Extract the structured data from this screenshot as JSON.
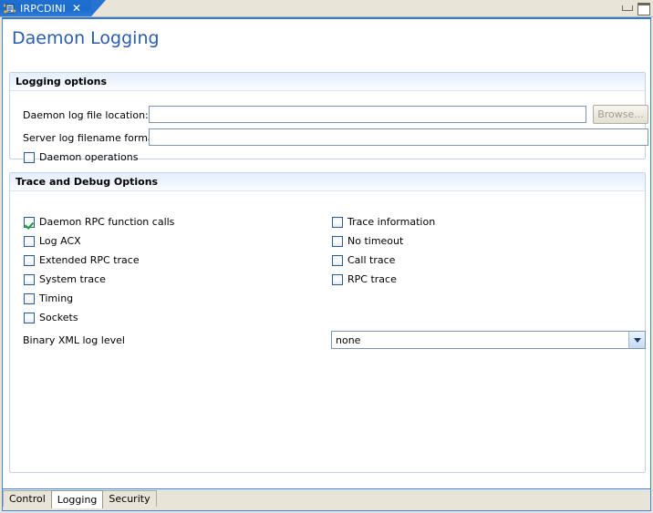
{
  "window": {
    "minimize_icon": "minimize-icon",
    "maximize_icon": "maximize-icon"
  },
  "editor_tab": {
    "label": "IRPCDINI",
    "close_label": "✕",
    "icon": "config-file-icon"
  },
  "page": {
    "title": "Daemon Logging"
  },
  "logging_options": {
    "header": "Logging options",
    "log_file_location_label": "Daemon log file location:",
    "log_file_location_value": "",
    "log_file_location_placeholder": "",
    "browse_label": "Browse...",
    "server_log_format_label": "Server log filename format:",
    "server_log_format_value": "",
    "server_log_format_placeholder": "",
    "daemon_operations_label": "Daemon operations",
    "daemon_operations_checked": false
  },
  "trace_debug": {
    "header": "Trace and Debug Options",
    "left_checkboxes": [
      {
        "label": "Daemon RPC function calls",
        "checked": true
      },
      {
        "label": "Log ACX",
        "checked": false
      },
      {
        "label": "Extended RPC trace",
        "checked": false
      },
      {
        "label": "System trace",
        "checked": false
      },
      {
        "label": "Timing",
        "checked": false
      },
      {
        "label": "Sockets",
        "checked": false
      }
    ],
    "right_checkboxes": [
      {
        "label": "Trace information",
        "checked": false
      },
      {
        "label": "No timeout",
        "checked": false
      },
      {
        "label": "Call trace",
        "checked": false
      },
      {
        "label": "RPC trace",
        "checked": false
      }
    ],
    "binary_xml_label": "Binary XML log level",
    "binary_xml_value": "none",
    "binary_xml_options": [
      "none"
    ],
    "dropdown_icon": "chevron-down-icon"
  },
  "bottom_tabs": [
    {
      "label": "Control",
      "active": false
    },
    {
      "label": "Logging",
      "active": true
    },
    {
      "label": "Security",
      "active": false
    }
  ],
  "colors": {
    "tab_blue": "#2672d2",
    "title_blue": "#2a5db0",
    "frame_blue": "#3f8ae0",
    "chrome_beige": "#e8e4d8",
    "check_green": "#1f9a35"
  }
}
